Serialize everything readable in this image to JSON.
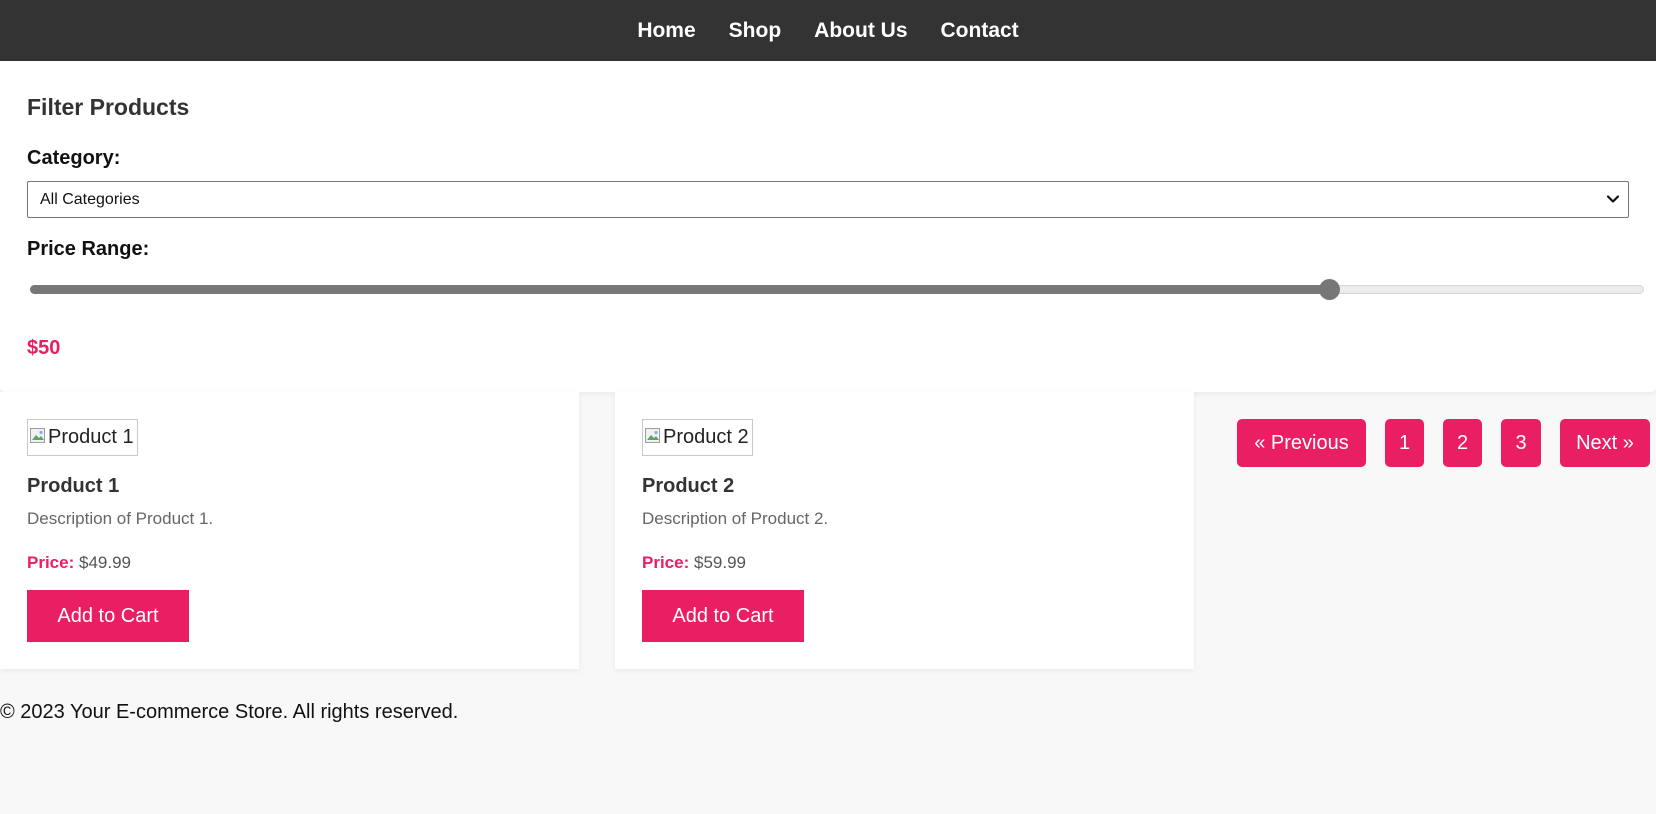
{
  "nav": {
    "items": [
      "Home",
      "Shop",
      "About Us",
      "Contact"
    ]
  },
  "filter": {
    "title": "Filter Products",
    "category_label": "Category:",
    "category_selected": "All Categories",
    "price_label": "Price Range:",
    "price_value": "$50",
    "price_slider_fraction": 0.805
  },
  "products": [
    {
      "image_alt": "Product 1",
      "name": "Product 1",
      "description": "Description of Product 1.",
      "price_label": "Price:",
      "price": "$49.99",
      "button": "Add to Cart"
    },
    {
      "image_alt": "Product 2",
      "name": "Product 2",
      "description": "Description of Product 2.",
      "price_label": "Price:",
      "price": "$59.99",
      "button": "Add to Cart"
    }
  ],
  "pagination": {
    "previous": "« Previous",
    "pages": [
      "1",
      "2",
      "3"
    ],
    "next": "Next »"
  },
  "footer": {
    "text": "© 2023 Your E-commerce Store. All rights reserved."
  },
  "colors": {
    "accent": "#e91e63",
    "navbar": "#333333",
    "slider": "#777777",
    "background": "#f8f8f8"
  },
  "icons": {
    "select_arrow": "chevron-down-icon",
    "broken_image": "broken-image-icon"
  }
}
